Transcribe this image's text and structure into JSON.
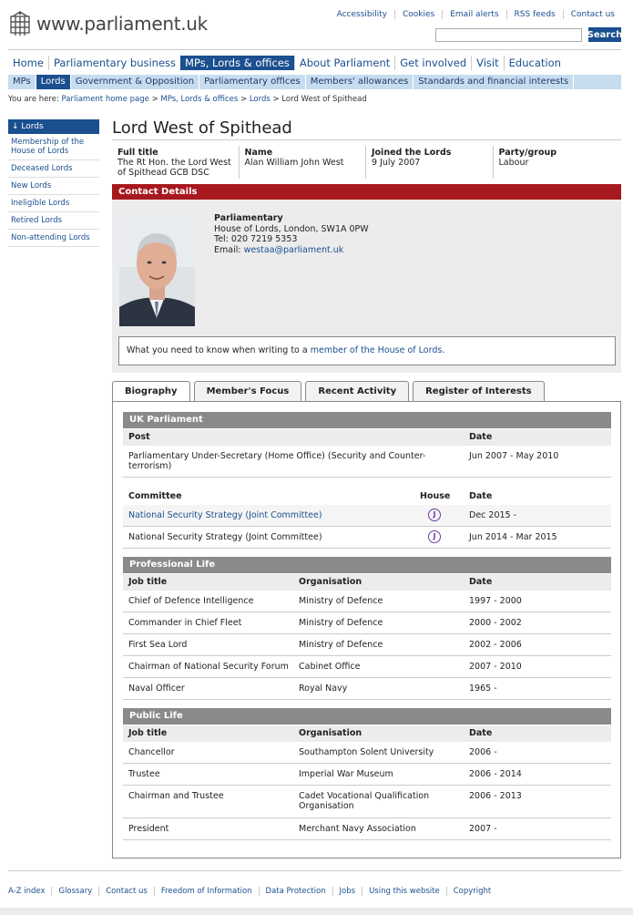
{
  "header": {
    "site_name": "www.parliament.uk",
    "top_links": [
      "Accessibility",
      "Cookies",
      "Email alerts",
      "RSS feeds",
      "Contact us"
    ],
    "search_button": "Search"
  },
  "main_nav": [
    {
      "label": "Home"
    },
    {
      "label": "Parliamentary business"
    },
    {
      "label": "MPs, Lords & offices",
      "active": true
    },
    {
      "label": "About Parliament"
    },
    {
      "label": "Get involved"
    },
    {
      "label": "Visit"
    },
    {
      "label": "Education"
    }
  ],
  "sub_nav": [
    {
      "label": "MPs"
    },
    {
      "label": "Lords",
      "active": true
    },
    {
      "label": "Government & Opposition"
    },
    {
      "label": "Parliamentary offices"
    },
    {
      "label": "Members' allowances"
    },
    {
      "label": "Standards and financial interests"
    }
  ],
  "breadcrumb": {
    "prefix": "You are here:",
    "links": [
      "Parliament home page",
      "MPs, Lords & offices",
      "Lords"
    ],
    "separator": ">",
    "current": "Lord West of Spithead"
  },
  "sidebar": {
    "head": "↓ Lords",
    "items": [
      "Membership of the House of Lords",
      "Deceased Lords",
      "New Lords",
      "Ineligible Lords",
      "Retired Lords",
      "Non-attending Lords"
    ]
  },
  "member": {
    "title": "Lord West of Spithead",
    "facts": [
      {
        "label": "Full title",
        "value": "The Rt Hon. the Lord West of Spithead GCB DSC"
      },
      {
        "label": "Name",
        "value": "Alan William John West"
      },
      {
        "label": "Joined the Lords",
        "value": "9 July 2007"
      },
      {
        "label": "Party/group",
        "value": "Labour"
      }
    ]
  },
  "contact": {
    "heading": "Contact Details",
    "label": "Parliamentary",
    "address": "House of Lords, London, SW1A 0PW",
    "tel": "Tel: 020 7219 5353",
    "email_prefix": "Email: ",
    "email": "westaa@parliament.uk",
    "notice_text": "What you need to know when writing to a ",
    "notice_link": "member of the House of Lords",
    "notice_end": "."
  },
  "tabs": [
    {
      "label": "Biography",
      "active": true
    },
    {
      "label": "Member's Focus"
    },
    {
      "label": "Recent Activity"
    },
    {
      "label": "Register of Interests"
    }
  ],
  "biography": {
    "uk_parliament": {
      "heading": "UK Parliament",
      "post_headers": [
        "Post",
        "Date"
      ],
      "posts": [
        {
          "post": "Parliamentary Under-Secretary (Home Office) (Security and Counter-terrorism)",
          "date": "Jun 2007 - May 2010"
        }
      ],
      "committee_headers": [
        "Committee",
        "House",
        "Date"
      ],
      "committees": [
        {
          "name": "National Security Strategy (Joint Committee)",
          "house": "J",
          "date": "Dec 2015 -",
          "link": true
        },
        {
          "name": "National Security Strategy (Joint Committee)",
          "house": "J",
          "date": "Jun 2014 - Mar 2015",
          "link": false
        }
      ]
    },
    "professional_life": {
      "heading": "Professional Life",
      "headers": [
        "Job title",
        "Organisation",
        "Date"
      ],
      "rows": [
        {
          "job": "Chief of Defence Intelligence",
          "org": "Ministry of Defence",
          "date": "1997 - 2000"
        },
        {
          "job": "Commander in Chief Fleet",
          "org": "Ministry of Defence",
          "date": "2000 - 2002"
        },
        {
          "job": "First Sea Lord",
          "org": "Ministry of Defence",
          "date": "2002 - 2006"
        },
        {
          "job": "Chairman of National Security Forum",
          "org": "Cabinet Office",
          "date": "2007 - 2010"
        },
        {
          "job": "Naval Officer",
          "org": "Royal Navy",
          "date": "1965 -"
        }
      ]
    },
    "public_life": {
      "heading": "Public Life",
      "headers": [
        "Job title",
        "Organisation",
        "Date"
      ],
      "rows": [
        {
          "job": "Chancellor",
          "org": "Southampton Solent University",
          "date": "2006 -"
        },
        {
          "job": "Trustee",
          "org": "Imperial War Museum",
          "date": "2006 - 2014"
        },
        {
          "job": "Chairman and Trustee",
          "org": "Cadet Vocational Qualification Organisation",
          "date": "2006 - 2013"
        },
        {
          "job": "President",
          "org": "Merchant Navy Association",
          "date": "2007 -"
        }
      ]
    }
  },
  "footer": {
    "links": [
      "A-Z index",
      "Glossary",
      "Contact us",
      "Freedom of Information",
      "Data Protection",
      "Jobs",
      "Using this website",
      "Copyright"
    ]
  },
  "colors": {
    "brand_blue": "#1b4f8f",
    "contact_red": "#a7191e",
    "joint_badge": "#6b3aa0"
  }
}
